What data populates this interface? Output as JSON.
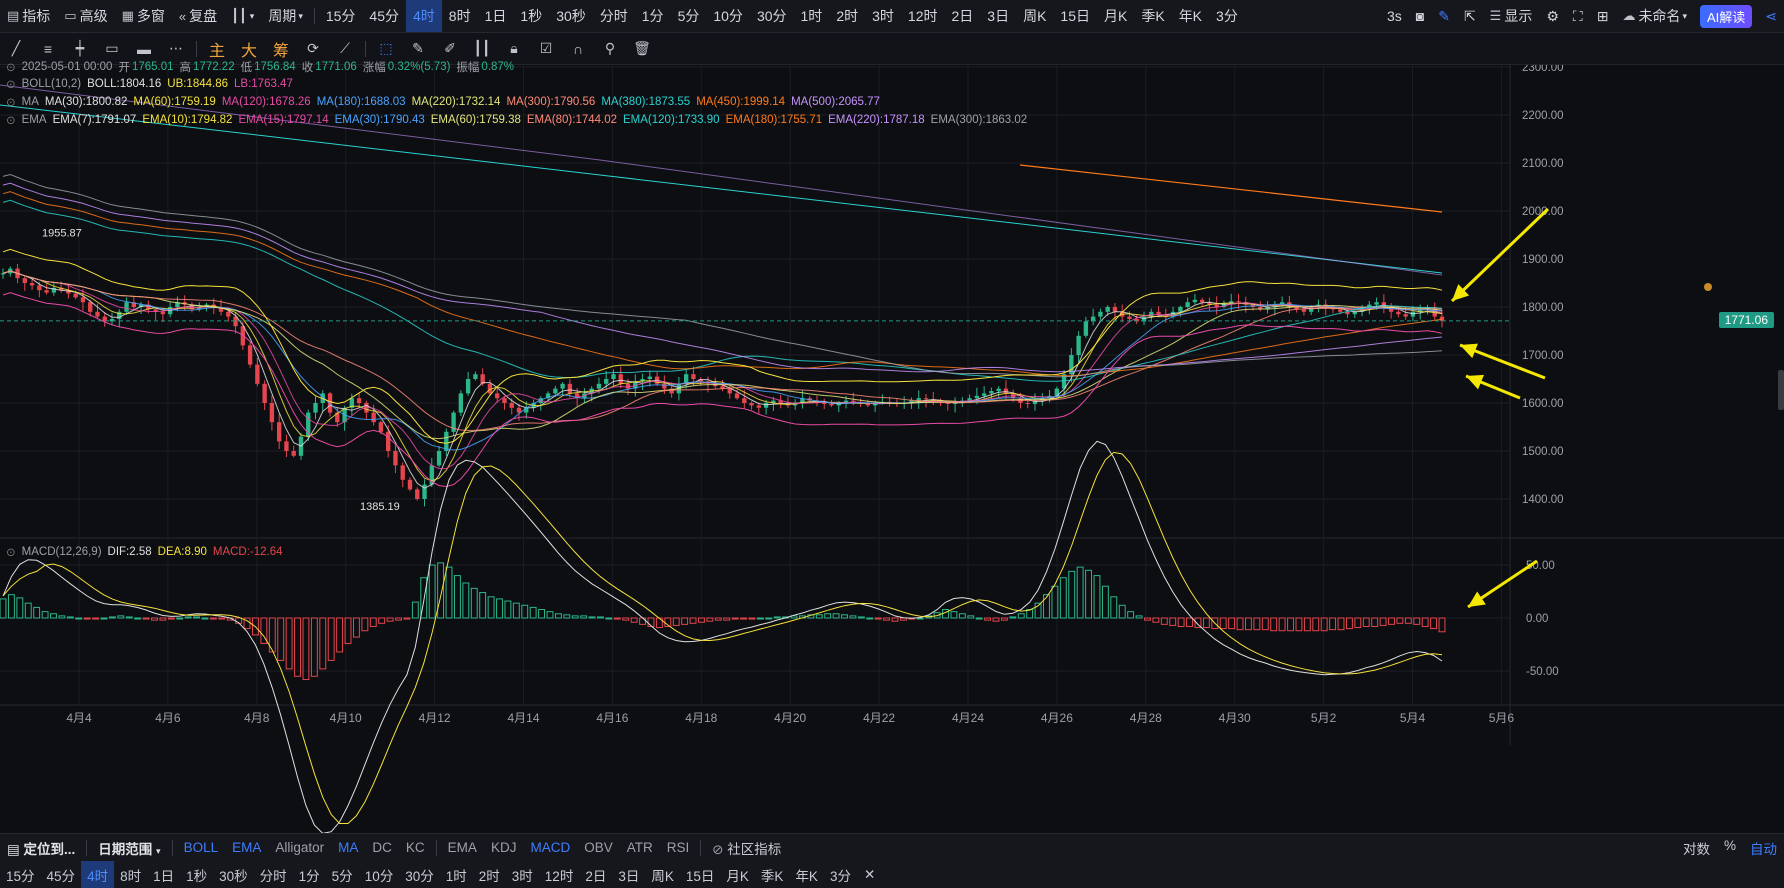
{
  "topbar": {
    "indicator_label": "指标",
    "advanced_label": "高级",
    "multiwindow_label": "多窗",
    "replay_label": "复盘",
    "period_label": "周期",
    "periods": [
      "15分",
      "45分",
      "4时",
      "8时",
      "1日",
      "1秒",
      "30秒",
      "分时",
      "1分",
      "5分",
      "10分",
      "30分",
      "1时",
      "2时",
      "3时",
      "12时",
      "2日",
      "3日",
      "周K",
      "15日",
      "月K",
      "季K",
      "年K",
      "3分"
    ],
    "active_period": "4时",
    "refresh_label": "3s",
    "display_label": "显示",
    "unnamed_label": "未命名",
    "ai_label": "AI解读"
  },
  "drawbar": {
    "main_label": "主",
    "big_label": "大",
    "chip_label": "筹"
  },
  "legend": {
    "ohlc": {
      "date": "2025-05-01 00:00",
      "open_label": "开",
      "open": "1765.01",
      "high_label": "高",
      "high": "1772.22",
      "low_label": "低",
      "low": "1756.84",
      "close_label": "收",
      "close": "1771.06",
      "change_label": "涨幅",
      "change": "0.32%(5.73)",
      "amp_label": "振幅",
      "amp": "0.87%"
    },
    "boll": {
      "name": "BOLL(10,2)",
      "boll": "BOLL:1804.16",
      "ub": "UB:1844.86",
      "lb": "LB:1763.47"
    },
    "ma": {
      "name": "MA",
      "items": [
        {
          "text": "MA(30):1800.82",
          "color": "#e0e0e0"
        },
        {
          "text": "MA(60):1759.19",
          "color": "#f5e23b"
        },
        {
          "text": "MA(120):1678.26",
          "color": "#e84aa6"
        },
        {
          "text": "MA(180):1688.03",
          "color": "#4aa3ff"
        },
        {
          "text": "MA(220):1732.14",
          "color": "#e3e67a"
        },
        {
          "text": "MA(300):1790.56",
          "color": "#ff8a78"
        },
        {
          "text": "MA(380):1873.55",
          "color": "#29d3d0"
        },
        {
          "text": "MA(450):1999.14",
          "color": "#ff7a1a"
        },
        {
          "text": "MA(500):2065.77",
          "color": "#c792ff"
        }
      ]
    },
    "ema": {
      "name": "EMA",
      "items": [
        {
          "text": "EMA(7):1791.07",
          "color": "#e0e0e0"
        },
        {
          "text": "EMA(10):1794.82",
          "color": "#f5e23b"
        },
        {
          "text": "EMA(15):1797.14",
          "color": "#e84aa6"
        },
        {
          "text": "EMA(30):1790.43",
          "color": "#4aa3ff"
        },
        {
          "text": "EMA(60):1759.38",
          "color": "#e3e67a"
        },
        {
          "text": "EMA(80):1744.02",
          "color": "#ff8a78"
        },
        {
          "text": "EMA(120):1733.90",
          "color": "#29d3d0"
        },
        {
          "text": "EMA(180):1755.71",
          "color": "#ff7a1a"
        },
        {
          "text": "EMA(220):1787.18",
          "color": "#c792ff"
        },
        {
          "text": "EMA(300):1863.02",
          "color": "#9ca0a8"
        }
      ]
    },
    "macd": {
      "name": "MACD(12,26,9)",
      "dif": "DIF:2.58",
      "dea": "DEA:8.90",
      "macd": "MACD:-12.64"
    }
  },
  "chart_data": {
    "type": "candlestick",
    "price_axis": {
      "ticks": [
        "2300.00",
        "2200.00",
        "2100.00",
        "2000.00",
        "1900.00",
        "1800.00",
        "1700.00",
        "1600.00",
        "1500.00",
        "1400.00"
      ],
      "current": "1771.06"
    },
    "macd_axis": {
      "ticks": [
        "50.00",
        "0.00",
        "-50.00"
      ]
    },
    "x_axis": {
      "ticks": [
        "4月4",
        "4月6",
        "4月8",
        "4月10",
        "4月12",
        "4月14",
        "4月16",
        "4月18",
        "4月20",
        "4月22",
        "4月24",
        "4月26",
        "4月28",
        "4月30",
        "5月2",
        "5月4",
        "5月6"
      ]
    },
    "annotations": {
      "high": "1955.87",
      "low": "1385.19"
    },
    "close_path": [
      1870,
      1880,
      1860,
      1850,
      1845,
      1835,
      1830,
      1840,
      1835,
      1828,
      1820,
      1810,
      1790,
      1780,
      1770,
      1775,
      1790,
      1810,
      1800,
      1805,
      1795,
      1790,
      1785,
      1800,
      1810,
      1805,
      1795,
      1800,
      1805,
      1798,
      1790,
      1780,
      1760,
      1720,
      1680,
      1640,
      1600,
      1560,
      1520,
      1500,
      1490,
      1530,
      1580,
      1600,
      1620,
      1580,
      1560,
      1590,
      1610,
      1600,
      1580,
      1560,
      1540,
      1500,
      1470,
      1440,
      1420,
      1400,
      1430,
      1470,
      1500,
      1540,
      1580,
      1620,
      1650,
      1660,
      1640,
      1620,
      1610,
      1600,
      1590,
      1580,
      1590,
      1600,
      1610,
      1620,
      1630,
      1640,
      1620,
      1610,
      1620,
      1630,
      1640,
      1650,
      1660,
      1640,
      1630,
      1645,
      1650,
      1655,
      1640,
      1630,
      1620,
      1640,
      1660,
      1650,
      1645,
      1640,
      1635,
      1630,
      1620,
      1610,
      1600,
      1595,
      1590,
      1600,
      1605,
      1598,
      1595,
      1600,
      1610,
      1605,
      1600,
      1598,
      1595,
      1600,
      1605,
      1600,
      1598,
      1595,
      1600,
      1602,
      1600,
      1598,
      1600,
      1605,
      1610,
      1608,
      1605,
      1600,
      1598,
      1600,
      1605,
      1610,
      1615,
      1620,
      1625,
      1630,
      1620,
      1610,
      1600,
      1598,
      1605,
      1610,
      1615,
      1630,
      1660,
      1700,
      1740,
      1770,
      1780,
      1790,
      1800,
      1790,
      1780,
      1775,
      1770,
      1780,
      1790,
      1785,
      1780,
      1790,
      1800,
      1810,
      1815,
      1810,
      1805,
      1800,
      1808,
      1812,
      1810,
      1805,
      1800,
      1795,
      1800,
      1805,
      1810,
      1800,
      1795,
      1790,
      1800,
      1805,
      1800,
      1795,
      1790,
      1785,
      1790,
      1800,
      1805,
      1810,
      1800,
      1790,
      1785,
      1780,
      1790,
      1795,
      1800,
      1780,
      1771
    ],
    "macd_hist": [
      18,
      22,
      19,
      14,
      10,
      6,
      4,
      2,
      1,
      0,
      -1,
      -1,
      0,
      1,
      2,
      1,
      0,
      -1,
      -2,
      -2,
      -1,
      0,
      1,
      1,
      0,
      -1,
      -1,
      -2,
      -5,
      -10,
      -16,
      -24,
      -32,
      -40,
      -48,
      -55,
      -58,
      -55,
      -48,
      -40,
      -32,
      -24,
      -18,
      -12,
      -8,
      -5,
      -3,
      -2,
      -1,
      15,
      38,
      50,
      52,
      48,
      40,
      33,
      28,
      24,
      20,
      18,
      16,
      14,
      12,
      10,
      8,
      6,
      4,
      3,
      2,
      2,
      1,
      1,
      0,
      -1,
      -2,
      -4,
      -6,
      -8,
      -9,
      -8,
      -7,
      -6,
      -5,
      -4,
      -3,
      -2,
      -2,
      -1,
      -1,
      -1,
      0,
      0,
      1,
      1,
      2,
      2,
      3,
      3,
      4,
      4,
      3,
      2,
      1,
      0,
      -1,
      -2,
      -3,
      -2,
      -1,
      0,
      2,
      5,
      8,
      6,
      4,
      2,
      0,
      -2,
      -3,
      -2,
      1,
      4,
      8,
      14,
      22,
      30,
      38,
      44,
      48,
      45,
      40,
      30,
      20,
      12,
      6,
      2,
      -2,
      -4,
      -6,
      -7,
      -8,
      -8,
      -9,
      -9,
      -10,
      -10,
      -10,
      -11,
      -11,
      -11,
      -11,
      -12,
      -12,
      -12,
      -12,
      -12,
      -12,
      -12,
      -11,
      -11,
      -10,
      -9,
      -8,
      -8,
      -7,
      -6,
      -5,
      -5,
      -6,
      -8,
      -10,
      -13
    ]
  },
  "bottombar1": {
    "locate_label": "定位到...",
    "range_label": "日期范围",
    "main_indicators": [
      "BOLL",
      "EMA",
      "Alligator",
      "MA",
      "DC",
      "KC"
    ],
    "main_active": [
      "BOLL",
      "EMA",
      "MA"
    ],
    "sub_indicators": [
      "EMA",
      "KDJ",
      "MACD",
      "OBV",
      "ATR",
      "RSI"
    ],
    "sub_active": [
      "MACD"
    ],
    "community_label": "社区指标",
    "log_label": "对数",
    "pct_label": "%",
    "auto_label": "自动"
  },
  "bottombar2": {
    "periods": [
      "15分",
      "45分",
      "4时",
      "8时",
      "1日",
      "1秒",
      "30秒",
      "分时",
      "1分",
      "5分",
      "10分",
      "30分",
      "1时",
      "2时",
      "3时",
      "12时",
      "2日",
      "3日",
      "周K",
      "15日",
      "月K",
      "季K",
      "年K",
      "3分"
    ],
    "active": "4时",
    "close_label": "✕"
  },
  "colors": {
    "up": "#2bb78a",
    "down": "#e5454d",
    "accent": "#3d7eff",
    "bg": "#0d0e12",
    "annotation_arrow": "#f5e800"
  }
}
